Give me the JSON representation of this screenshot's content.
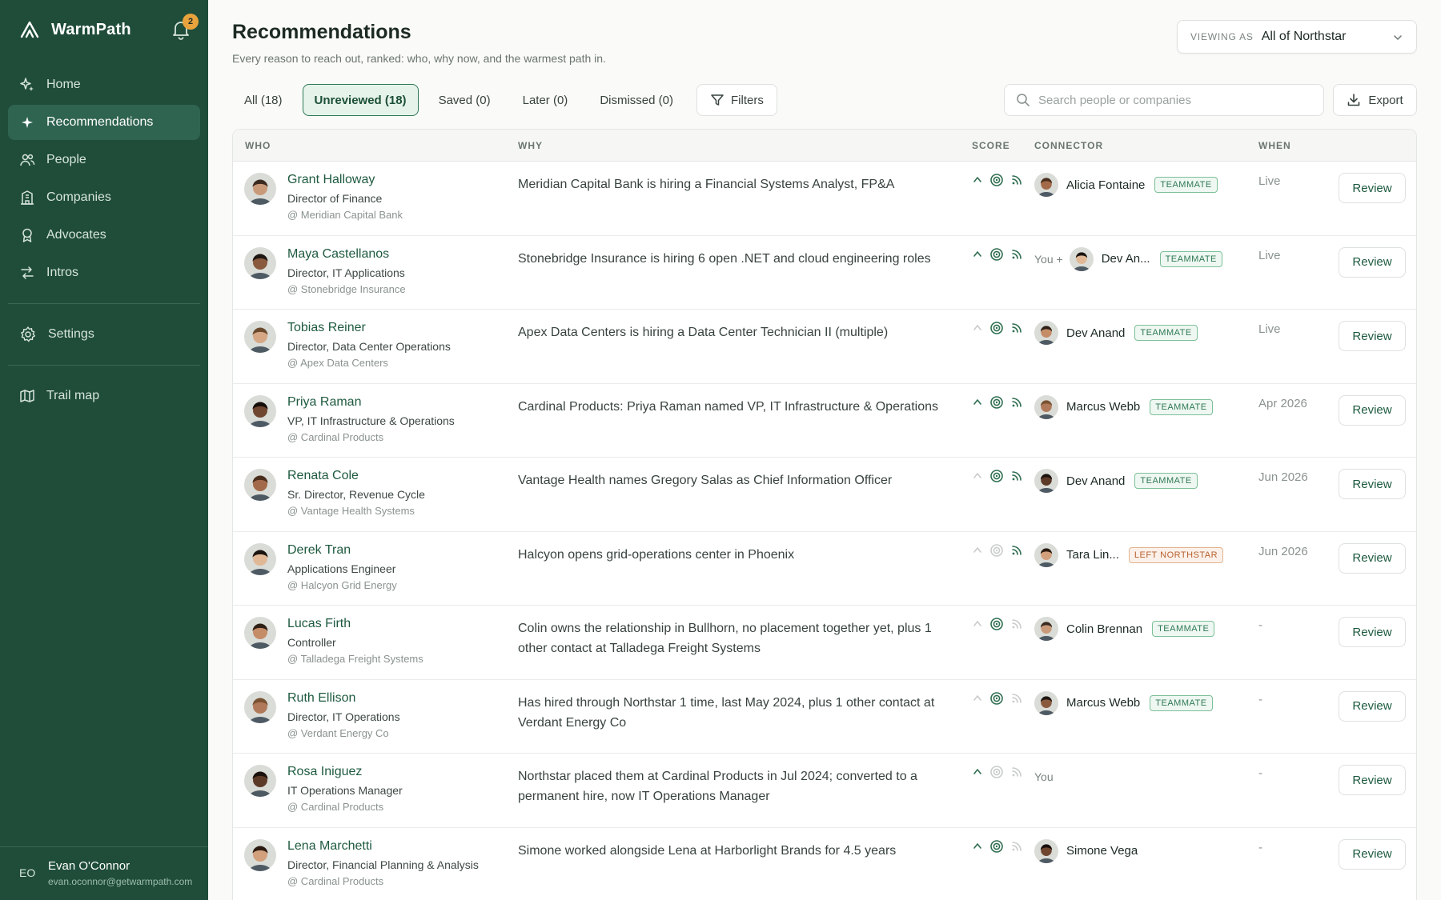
{
  "app": {
    "name": "WarmPath",
    "notification_count": "2"
  },
  "nav": {
    "items": [
      {
        "label": "Home",
        "icon": "sparkle-home-icon"
      },
      {
        "label": "Recommendations",
        "icon": "sparkle-icon"
      },
      {
        "label": "People",
        "icon": "people-icon"
      },
      {
        "label": "Companies",
        "icon": "building-icon"
      },
      {
        "label": "Advocates",
        "icon": "award-icon"
      },
      {
        "label": "Intros",
        "icon": "arrows-icon"
      },
      {
        "label": "Settings",
        "icon": "gear-icon"
      },
      {
        "label": "Trail map",
        "icon": "map-icon"
      }
    ],
    "active": "Recommendations"
  },
  "user": {
    "initials": "EO",
    "name": "Evan O'Connor",
    "email": "evan.oconnor@getwarmpath.com"
  },
  "header": {
    "title": "Recommendations",
    "subtitle": "Every reason to reach out, ranked: who, why now, and the warmest path in.",
    "viewing_label": "VIEWING AS",
    "viewing_value": "All of Northstar"
  },
  "tabs": [
    {
      "label": "All (18)",
      "active": false
    },
    {
      "label": "Unreviewed (18)",
      "active": true
    },
    {
      "label": "Saved (0)",
      "active": false
    },
    {
      "label": "Later (0)",
      "active": false
    },
    {
      "label": "Dismissed (0)",
      "active": false
    }
  ],
  "filters_label": "Filters",
  "search": {
    "placeholder": "Search people or companies"
  },
  "export_label": "Export",
  "columns": {
    "who": "WHO",
    "why": "WHY",
    "score": "SCORE",
    "connector": "CONNECTOR",
    "when": "WHEN"
  },
  "review_label": "Review",
  "colors": {
    "sidebar": "#1f4d3a",
    "accent": "#2f7a55",
    "link": "#1e5a3f",
    "badge_orange": "#b85f2c"
  },
  "rows": [
    {
      "name": "Grant Halloway",
      "title": "Director of Finance",
      "company": "@ Meridian Capital Bank",
      "why": "Meridian Capital Bank is hiring a Financial Systems Analyst, FP&A",
      "scores": [
        true,
        true,
        true
      ],
      "connector_prefix": "",
      "connector": "Alicia Fontaine",
      "badge": "TEAMMATE",
      "badge_type": "green",
      "when": "Live"
    },
    {
      "name": "Maya Castellanos",
      "title": "Director, IT Applications",
      "company": "@ Stonebridge Insurance",
      "why": "Stonebridge Insurance is hiring 6 open .NET and cloud engineering roles",
      "scores": [
        true,
        true,
        true
      ],
      "connector_prefix": "You +",
      "connector": "Dev An...",
      "badge": "TEAMMATE",
      "badge_type": "green",
      "when": "Live"
    },
    {
      "name": "Tobias Reiner",
      "title": "Director, Data Center Operations",
      "company": "@ Apex Data Centers",
      "why": "Apex Data Centers is hiring a Data Center Technician II (multiple)",
      "scores": [
        false,
        true,
        true
      ],
      "connector_prefix": "",
      "connector": "Dev Anand",
      "badge": "TEAMMATE",
      "badge_type": "green",
      "when": "Live"
    },
    {
      "name": "Priya Raman",
      "title": "VP, IT Infrastructure & Operations",
      "company": "@ Cardinal Products",
      "why": "Cardinal Products: Priya Raman named VP, IT Infrastructure & Operations",
      "scores": [
        true,
        true,
        true
      ],
      "connector_prefix": "",
      "connector": "Marcus Webb",
      "badge": "TEAMMATE",
      "badge_type": "green",
      "when": "Apr 2026"
    },
    {
      "name": "Renata Cole",
      "title": "Sr. Director, Revenue Cycle",
      "company": "@ Vantage Health Systems",
      "why": "Vantage Health names Gregory Salas as Chief Information Officer",
      "scores": [
        false,
        true,
        true
      ],
      "connector_prefix": "",
      "connector": "Dev Anand",
      "badge": "TEAMMATE",
      "badge_type": "green",
      "when": "Jun 2026"
    },
    {
      "name": "Derek Tran",
      "title": "Applications Engineer",
      "company": "@ Halcyon Grid Energy",
      "why": "Halcyon opens grid-operations center in Phoenix",
      "scores": [
        false,
        false,
        true
      ],
      "connector_prefix": "",
      "connector": "Tara Lin...",
      "badge": "LEFT NORTHSTAR",
      "badge_type": "orange",
      "when": "Jun 2026"
    },
    {
      "name": "Lucas Firth",
      "title": "Controller",
      "company": "@ Talladega Freight Systems",
      "why": "Colin owns the relationship in Bullhorn, no placement together yet, plus 1 other contact at Talladega Freight Systems",
      "scores": [
        false,
        true,
        false
      ],
      "connector_prefix": "",
      "connector": "Colin Brennan",
      "badge": "TEAMMATE",
      "badge_type": "green",
      "when": "-"
    },
    {
      "name": "Ruth Ellison",
      "title": "Director, IT Operations",
      "company": "@ Verdant Energy Co",
      "why": "Has hired through Northstar 1 time, last May 2024, plus 1 other contact at Verdant Energy Co",
      "scores": [
        false,
        true,
        false
      ],
      "connector_prefix": "",
      "connector": "Marcus Webb",
      "badge": "TEAMMATE",
      "badge_type": "green",
      "when": "-"
    },
    {
      "name": "Rosa Iniguez",
      "title": "IT Operations Manager",
      "company": "@ Cardinal Products",
      "why": "Northstar placed them at Cardinal Products in Jul 2024; converted to a permanent hire, now IT Operations Manager",
      "scores": [
        true,
        false,
        false
      ],
      "connector_prefix": "You",
      "connector": "",
      "badge": "",
      "badge_type": "",
      "when": "-"
    },
    {
      "name": "Lena Marchetti",
      "title": "Director, Financial Planning & Analysis",
      "company": "@ Cardinal Products",
      "why": "Simone worked alongside Lena at Harborlight Brands for 4.5 years",
      "scores": [
        true,
        true,
        false
      ],
      "connector_prefix": "",
      "connector": "Simone Vega",
      "badge": "",
      "badge_type": "",
      "when": "-"
    }
  ]
}
